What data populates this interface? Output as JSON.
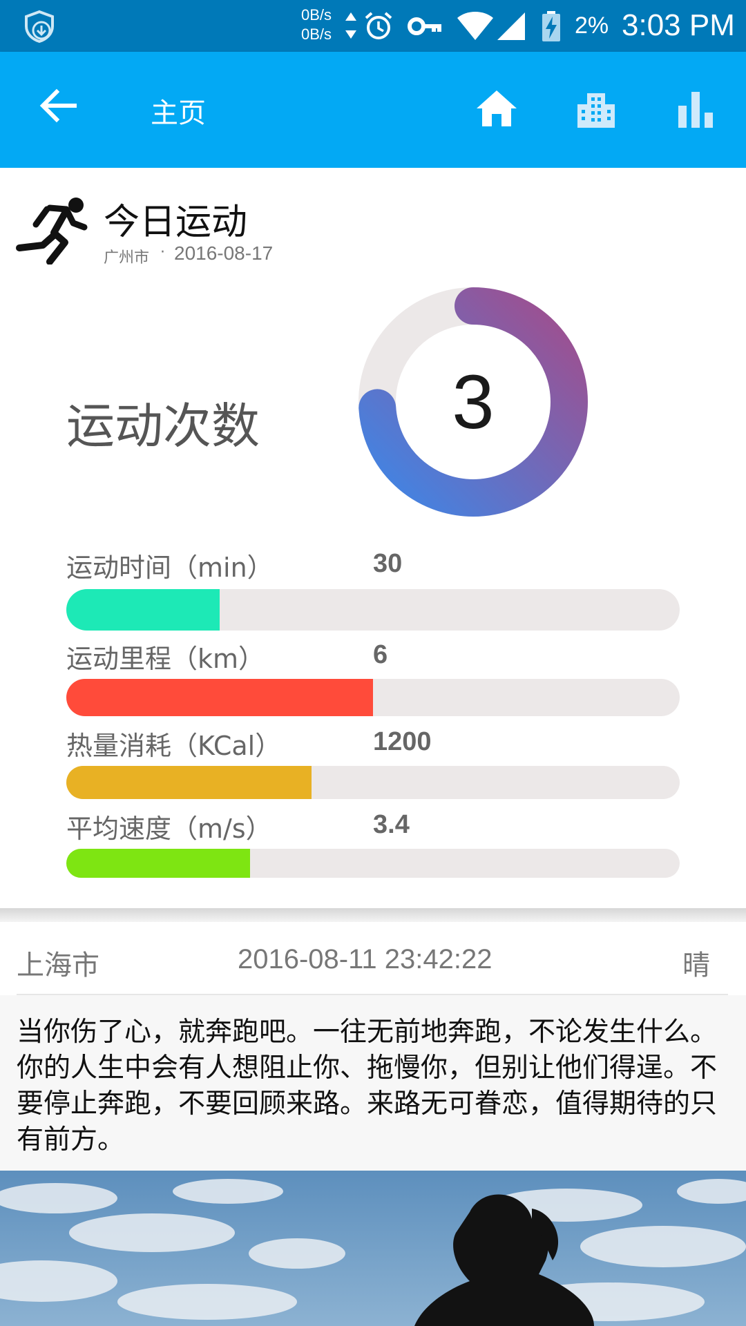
{
  "status_bar": {
    "net_up": "0B/s",
    "net_down": "0B/s",
    "battery_percent": "2%",
    "time": "3:03 PM",
    "icons": [
      "shield-download-icon",
      "net-arrows-icon",
      "alarm-icon",
      "vpn-key-icon",
      "wifi-icon",
      "signal-icon",
      "battery-charging-icon"
    ]
  },
  "app_bar": {
    "title": "主页",
    "back_icon": "arrow-back-icon",
    "actions": [
      "home-icon",
      "city-icon",
      "bar-chart-icon"
    ]
  },
  "today": {
    "heading": "今日运动",
    "location": "广州市",
    "separator": "·",
    "date": "2016-08-17",
    "count_label": "运动次数",
    "count": "3",
    "ring_fraction": 0.74,
    "metrics": [
      {
        "label": "运动时间（min）",
        "value": "30",
        "fraction": 0.25,
        "color": "#1de9b6"
      },
      {
        "label": "运动里程（km）",
        "value": "6",
        "fraction": 0.5,
        "color": "#ff4b3a"
      },
      {
        "label": "热量消耗（KCal）",
        "value": "1200",
        "fraction": 0.4,
        "color": "#e8b124"
      },
      {
        "label": "平均速度（m/s）",
        "value": "3.4",
        "fraction": 0.3,
        "color": "#7ee512"
      }
    ]
  },
  "feed": {
    "city": "上海市",
    "timestamp": "2016-08-11 23:42:22",
    "weather": "晴",
    "quote": "当你伤了心，就奔跑吧。一往无前地奔跑，不论发生什么。你的人生中会有人想阻止你、拖慢你，但别让他们得逞。不要停止奔跑，不要回顾来路。来路无可眷恋，值得期待的只有前方。"
  },
  "colors": {
    "status_bar": "#0079b8",
    "app_bar": "#03a9f4",
    "ring_start": "#3e86e6",
    "ring_end": "#a24d8c",
    "ring_track": "#ece8e8"
  }
}
